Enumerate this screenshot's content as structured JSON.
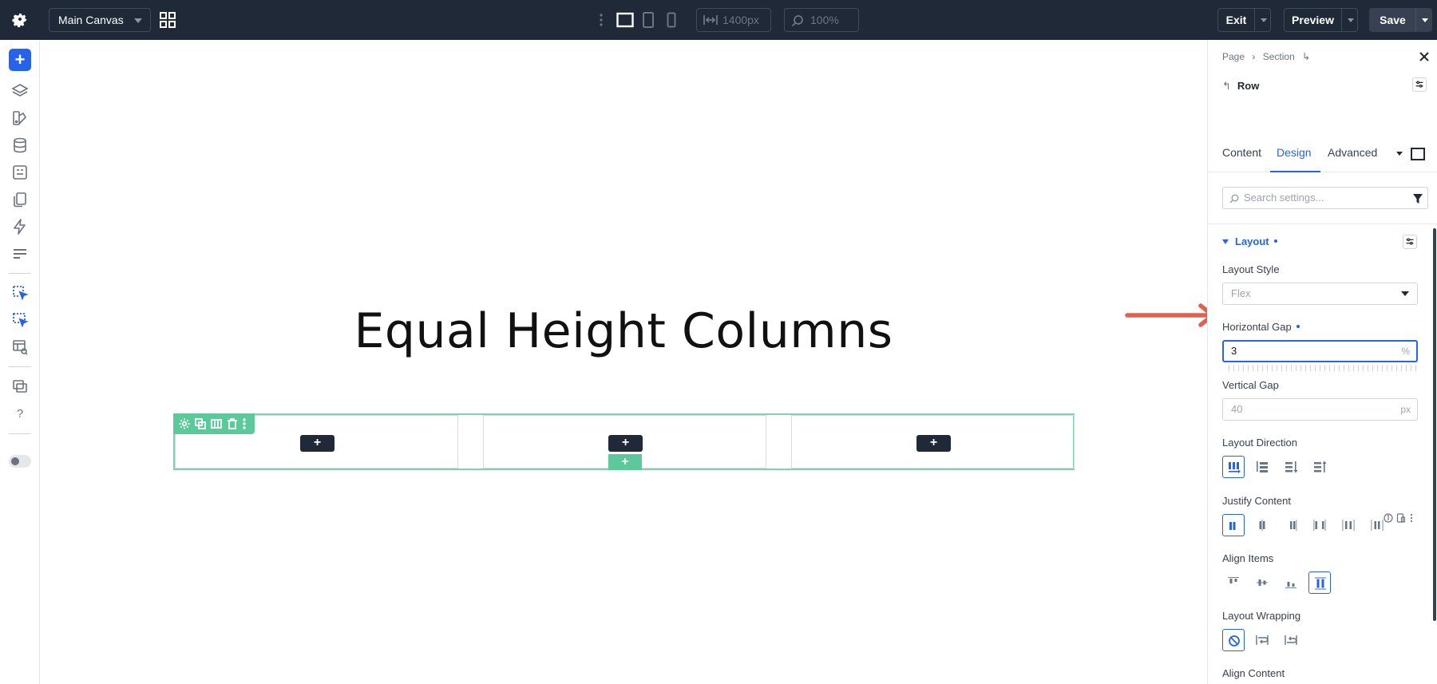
{
  "topbar": {
    "canvas_select": "Main Canvas",
    "width_value": "1400px",
    "zoom_value": "100%",
    "exit_label": "Exit",
    "preview_label": "Preview",
    "save_label": "Save"
  },
  "sidebar": {
    "add_label": "+",
    "help_label": "?"
  },
  "canvas": {
    "heading": "Equal Height Columns",
    "column_add_label": "+",
    "row_add_label": "+"
  },
  "panel": {
    "breadcrumb": [
      "Page",
      "Section"
    ],
    "breadcrumb_sep": "›",
    "element_title": "Row",
    "tabs": {
      "content": "Content",
      "design": "Design",
      "advanced": "Advanced"
    },
    "search_placeholder": "Search settings...",
    "section_title": "Layout",
    "layout_style": {
      "label": "Layout Style",
      "value": "Flex"
    },
    "horizontal_gap": {
      "label": "Horizontal Gap",
      "value": "3",
      "unit": "%"
    },
    "vertical_gap": {
      "label": "Vertical Gap",
      "value": "40",
      "unit": "px"
    },
    "layout_direction": {
      "label": "Layout Direction"
    },
    "justify_content": {
      "label": "Justify Content"
    },
    "align_items": {
      "label": "Align Items"
    },
    "layout_wrapping": {
      "label": "Layout Wrapping"
    },
    "align_content": {
      "label": "Align Content"
    }
  },
  "colors": {
    "accent": "#2563eb",
    "topbar": "#1f2937",
    "row_outline": "#7dd3b0",
    "annotation_arrow": "#e06052"
  }
}
